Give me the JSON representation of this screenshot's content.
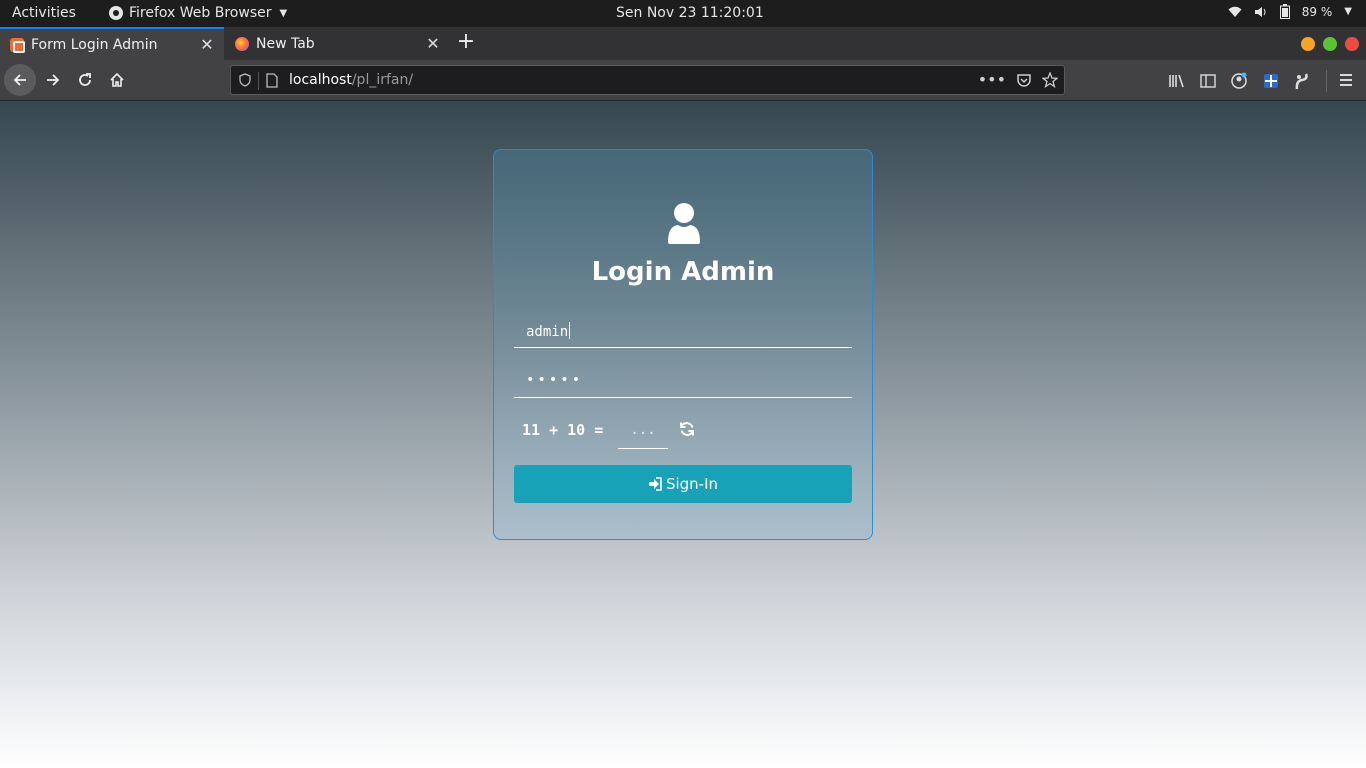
{
  "system": {
    "activities": "Activities",
    "app_name": "Firefox Web Browser",
    "clock": "Sen Nov 23  11:20:01",
    "battery": "89 %"
  },
  "tabs": [
    {
      "label": "Form Login Admin",
      "active": true
    },
    {
      "label": "New Tab",
      "active": false
    }
  ],
  "urlbar": {
    "host": "localhost",
    "path": "/pl_irfan/"
  },
  "login": {
    "title": "Login Admin",
    "username_value": "admin",
    "password_mask": "•••••",
    "captcha_question": "11 + 10 =",
    "captcha_placeholder": "...",
    "signin_label": "Sign-In"
  },
  "colors": {
    "button": "#17a2b8",
    "card_border": "#2a8bd6",
    "tab_accent": "#0a84ff"
  },
  "icons": [
    "user-icon",
    "refresh-icon",
    "sign-in-icon",
    "home-icon",
    "reload-icon",
    "back-icon",
    "forward-icon"
  ]
}
